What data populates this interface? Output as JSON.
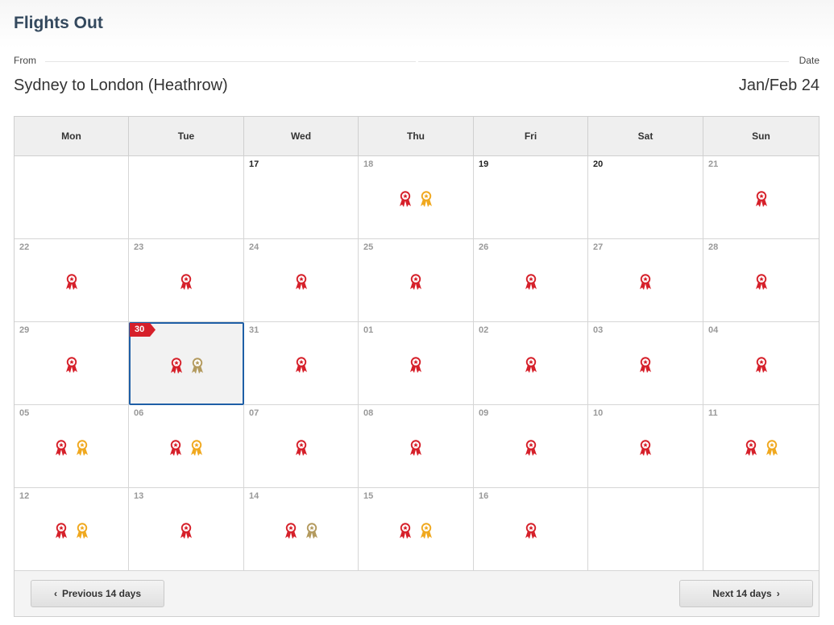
{
  "header": {
    "title": "Flights Out",
    "from_label": "From",
    "date_label": "Date",
    "route": "Sydney to London (Heathrow)",
    "date_range": "Jan/Feb 24"
  },
  "calendar": {
    "weekdays": [
      "Mon",
      "Tue",
      "Wed",
      "Thu",
      "Fri",
      "Sat",
      "Sun"
    ],
    "award_colors": {
      "red": "#d6202a",
      "gold": "#f0a81e",
      "bronze": "#b39a5e"
    },
    "weeks": [
      [
        {
          "day": "",
          "awards": []
        },
        {
          "day": "",
          "awards": []
        },
        {
          "day": "17",
          "awards": [],
          "dark": true
        },
        {
          "day": "18",
          "awards": [
            "red",
            "gold"
          ]
        },
        {
          "day": "19",
          "awards": [],
          "dark": true
        },
        {
          "day": "20",
          "awards": [],
          "dark": true
        },
        {
          "day": "21",
          "awards": [
            "red"
          ]
        }
      ],
      [
        {
          "day": "22",
          "awards": [
            "red"
          ]
        },
        {
          "day": "23",
          "awards": [
            "red"
          ]
        },
        {
          "day": "24",
          "awards": [
            "red"
          ]
        },
        {
          "day": "25",
          "awards": [
            "red"
          ]
        },
        {
          "day": "26",
          "awards": [
            "red"
          ]
        },
        {
          "day": "27",
          "awards": [
            "red"
          ]
        },
        {
          "day": "28",
          "awards": [
            "red"
          ]
        }
      ],
      [
        {
          "day": "29",
          "awards": [
            "red"
          ]
        },
        {
          "day": "30",
          "awards": [
            "red",
            "bronze"
          ],
          "selected": true
        },
        {
          "day": "31",
          "awards": [
            "red"
          ]
        },
        {
          "day": "01",
          "awards": [
            "red"
          ]
        },
        {
          "day": "02",
          "awards": [
            "red"
          ]
        },
        {
          "day": "03",
          "awards": [
            "red"
          ]
        },
        {
          "day": "04",
          "awards": [
            "red"
          ]
        }
      ],
      [
        {
          "day": "05",
          "awards": [
            "red",
            "gold"
          ]
        },
        {
          "day": "06",
          "awards": [
            "red",
            "gold"
          ]
        },
        {
          "day": "07",
          "awards": [
            "red"
          ]
        },
        {
          "day": "08",
          "awards": [
            "red"
          ]
        },
        {
          "day": "09",
          "awards": [
            "red"
          ]
        },
        {
          "day": "10",
          "awards": [
            "red"
          ]
        },
        {
          "day": "11",
          "awards": [
            "red",
            "gold"
          ]
        }
      ],
      [
        {
          "day": "12",
          "awards": [
            "red",
            "gold"
          ]
        },
        {
          "day": "13",
          "awards": [
            "red"
          ]
        },
        {
          "day": "14",
          "awards": [
            "red",
            "bronze"
          ]
        },
        {
          "day": "15",
          "awards": [
            "red",
            "gold"
          ]
        },
        {
          "day": "16",
          "awards": [
            "red"
          ]
        },
        {
          "day": "",
          "awards": []
        },
        {
          "day": "",
          "awards": []
        }
      ]
    ],
    "selected_flag_color": "#d6202a"
  },
  "footer": {
    "prev_label": "Previous 14 days",
    "next_label": "Next 14 days",
    "prev_icon": "chevron-left-icon",
    "next_icon": "chevron-right-icon"
  }
}
